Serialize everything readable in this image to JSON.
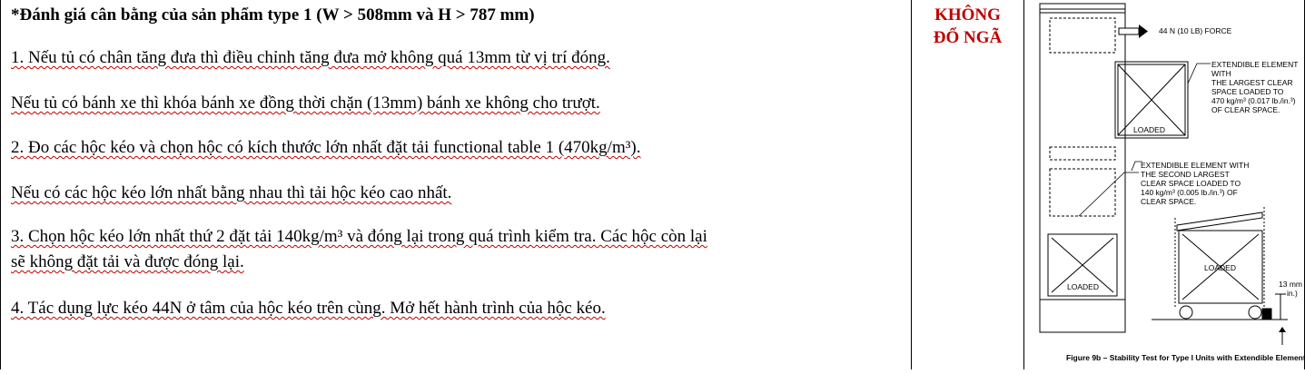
{
  "heading": "*Đánh giá cân bằng của sản phẩm type 1 (W > 508mm và H > 787 mm)",
  "steps": [
    "1. Nếu tủ có chân tăng đưa thì điều chỉnh tăng đưa mở không quá 13mm từ vị trí đóng.",
    "Nếu tủ có bánh xe thì khóa bánh xe đồng thời chặn (13mm) bánh xe không cho trượt.",
    "2. Đo các hộc kéo và chọn hộc có kích thước lớn nhất đặt tải functional table 1 (470kg/m³).",
    "Nếu có các hộc kéo lớn nhất bằng nhau thì tải hộc kéo cao nhất.",
    "3. Chọn hộc kéo lớn nhất thứ 2 đặt tải 140kg/m³ và đóng lại trong quá trình kiểm tra. Các hộc còn lại",
    "sẽ không đặt tải và được đóng lại.",
    "4. Tác dụng lực kéo 44N ở tâm của hộc kéo trên cùng. Mở hết hành trình của hộc kéo."
  ],
  "result": {
    "line1": "KHÔNG",
    "line2": "ĐỔ NGÃ",
    "color": "#c00000"
  },
  "figure": {
    "force_label": "44 N (10 LB) FORCE",
    "ext_element_lines": [
      "EXTENDIBLE ELEMENT",
      "WITH",
      "THE LARGEST CLEAR",
      "SPACE LOADED TO",
      "470 kg/m³ (0.017 lb./in.³)",
      "OF CLEAR SPACE."
    ],
    "second_element_lines": [
      "EXTENDIBLE ELEMENT WITH",
      "THE SECOND LARGEST",
      "CLEAR SPACE LOADED TO",
      "140 kg/m³ (0.005 lb./in.³) OF",
      "CLEAR SPACE."
    ],
    "loaded_label": "LOADED",
    "dimension_lines": [
      "13 mm (0.5",
      "in.)"
    ],
    "caption": "Figure 9b – Stability Test for Type I Units with Extendible Elements"
  }
}
